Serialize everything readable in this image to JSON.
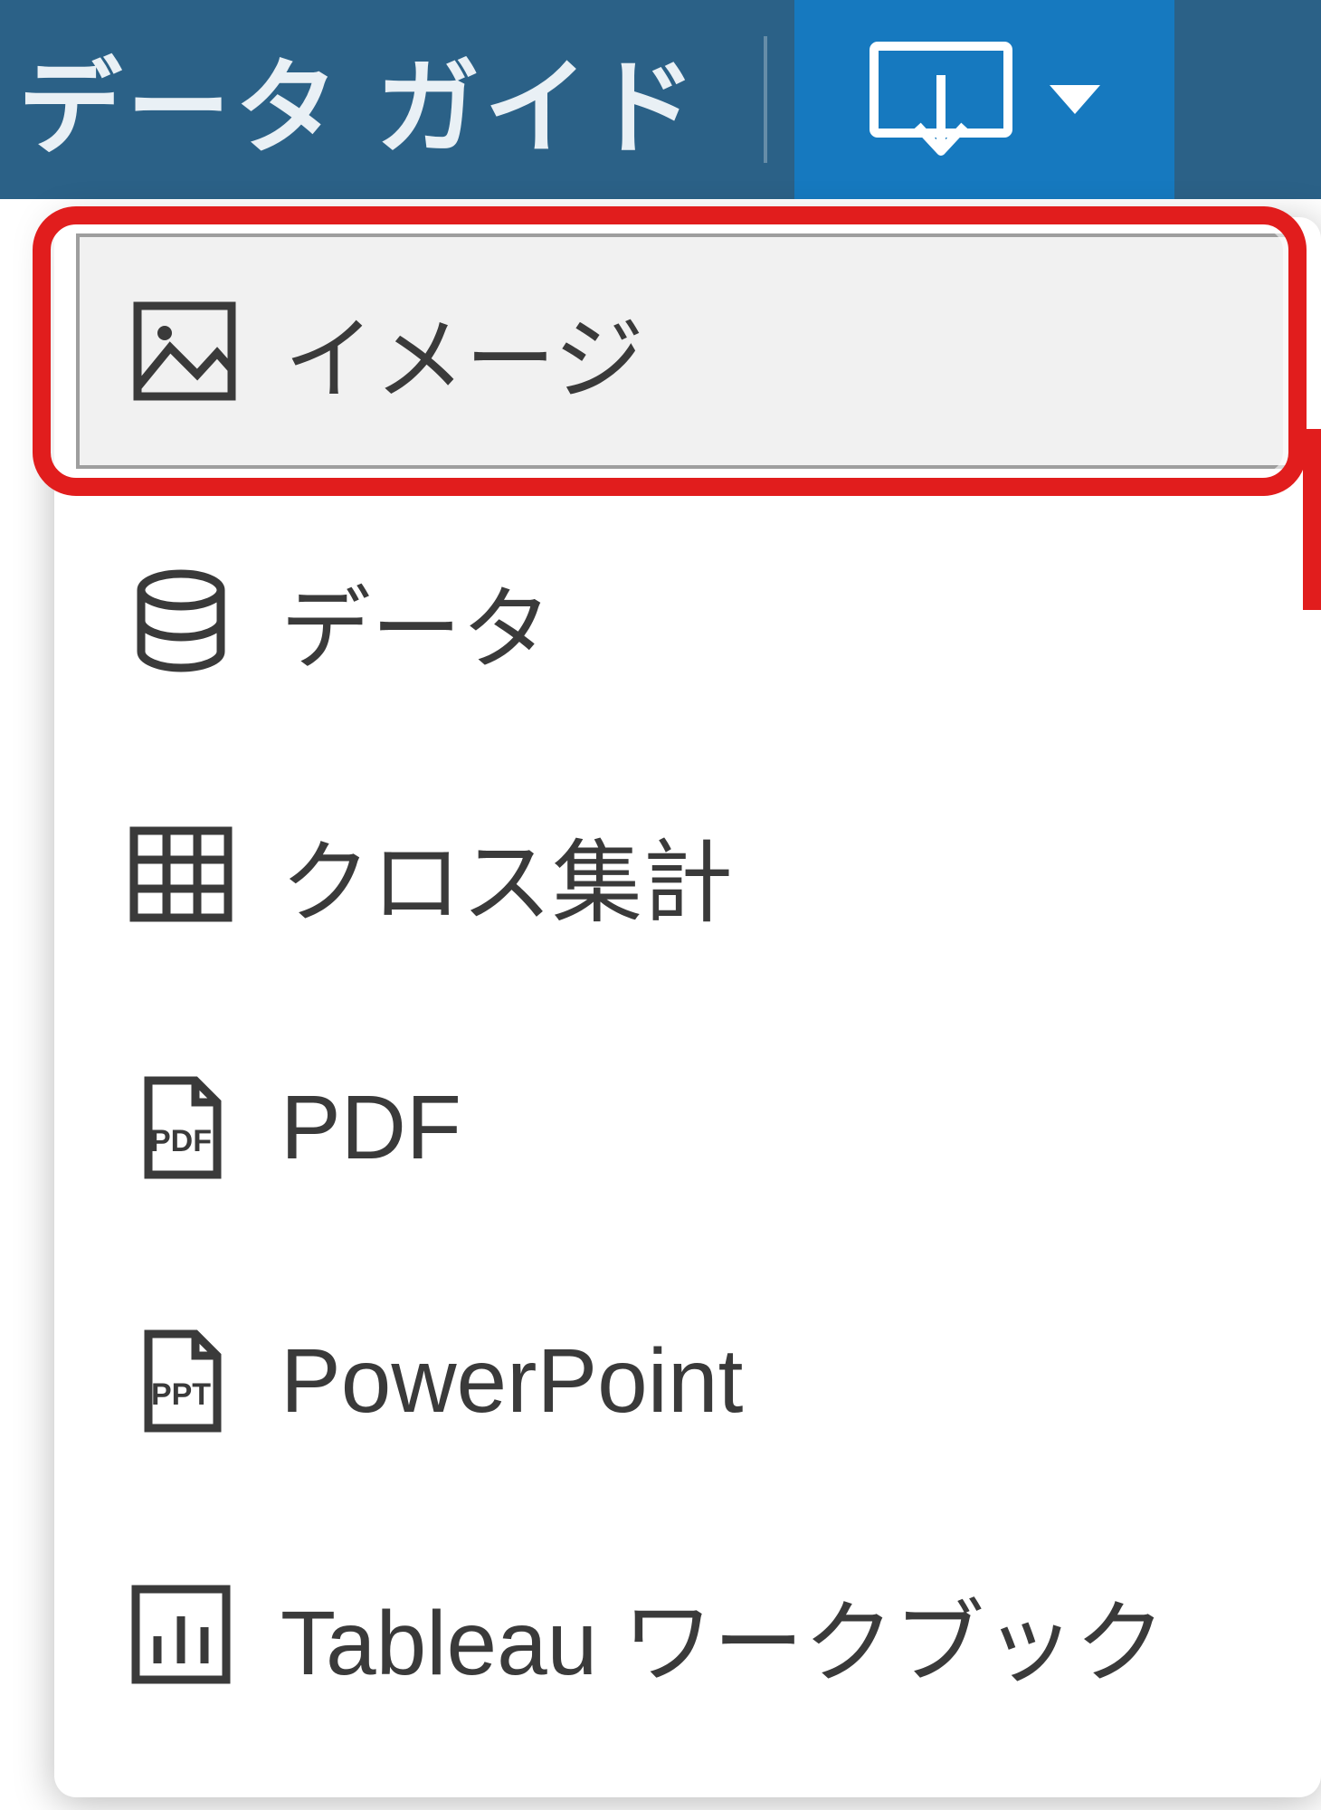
{
  "topbar": {
    "title": "データ ガイド"
  },
  "menu": {
    "items": [
      {
        "label": "イメージ",
        "icon": "image-icon"
      },
      {
        "label": "データ",
        "icon": "database-icon"
      },
      {
        "label": "クロス集計",
        "icon": "crosstab-icon"
      },
      {
        "label": "PDF",
        "icon": "pdf-icon"
      },
      {
        "label": "PowerPoint",
        "icon": "powerpoint-icon"
      },
      {
        "label": "Tableau ワークブック",
        "icon": "workbook-icon"
      }
    ]
  },
  "colors": {
    "topbar_bg": "#2b6187",
    "download_bg": "#1679bf",
    "callout": "#e11d1d"
  }
}
